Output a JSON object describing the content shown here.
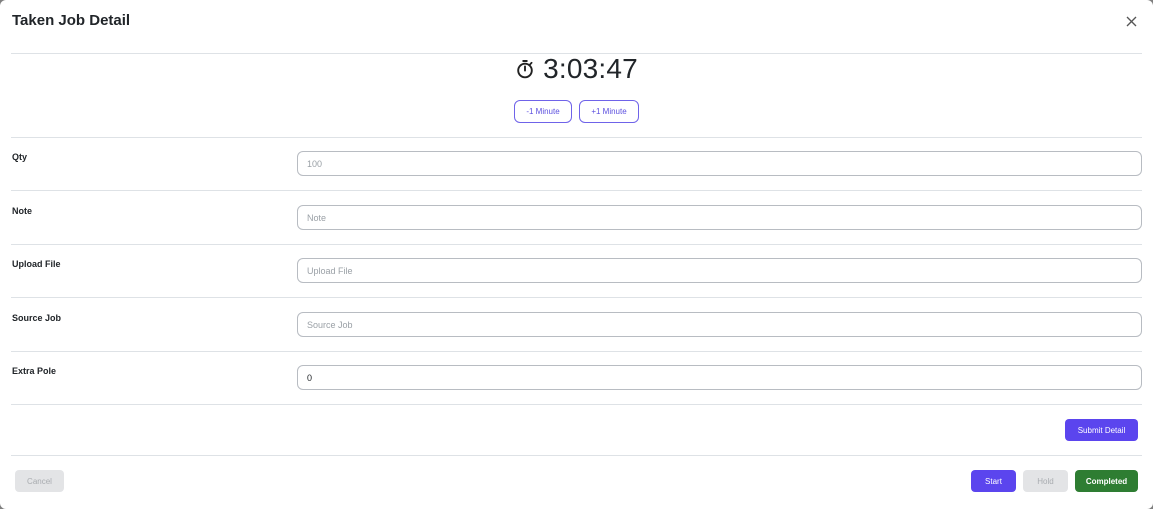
{
  "modal": {
    "title": "Taken Job Detail",
    "close_icon": "close-icon"
  },
  "timer": {
    "icon": "stopwatch-icon",
    "value": "3:03:47",
    "minus_label": "-1 Minute",
    "plus_label": "+1 Minute"
  },
  "fields": {
    "qty": {
      "label": "Qty",
      "placeholder": "100",
      "value": ""
    },
    "note": {
      "label": "Note",
      "placeholder": "Note",
      "value": ""
    },
    "upload_file": {
      "label": "Upload File",
      "placeholder": "Upload File",
      "value": ""
    },
    "source_job": {
      "label": "Source Job",
      "placeholder": "Source Job",
      "value": ""
    },
    "extra_pole": {
      "label": "Extra Pole",
      "placeholder": "",
      "value": "0"
    }
  },
  "actions": {
    "submit_detail": "Submit Detail",
    "cancel": "Cancel",
    "start": "Start",
    "hold": "Hold",
    "completed": "Completed"
  },
  "colors": {
    "primary": "#5b45ee",
    "success": "#2e7d32",
    "disabled": "#e3e4e6"
  }
}
